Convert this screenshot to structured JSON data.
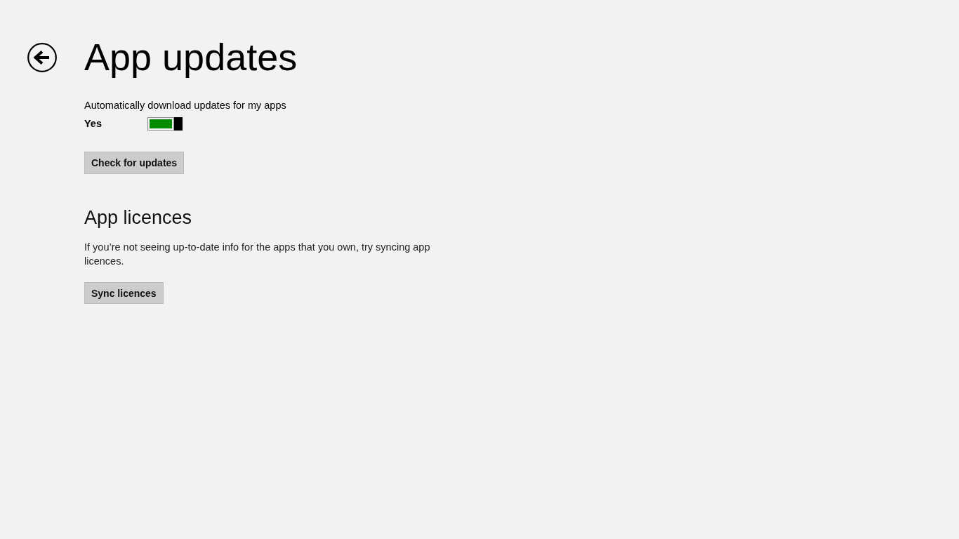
{
  "header": {
    "title": "App updates"
  },
  "auto_update": {
    "label": "Automatically download updates for my apps",
    "value_label": "Yes",
    "on": true
  },
  "check_button": {
    "label": "Check for updates"
  },
  "licences": {
    "heading": "App licences",
    "description": "If you’re not seeing up-to-date info for the apps that you own, try syncing app licences.",
    "button": {
      "label": "Sync licences"
    }
  }
}
